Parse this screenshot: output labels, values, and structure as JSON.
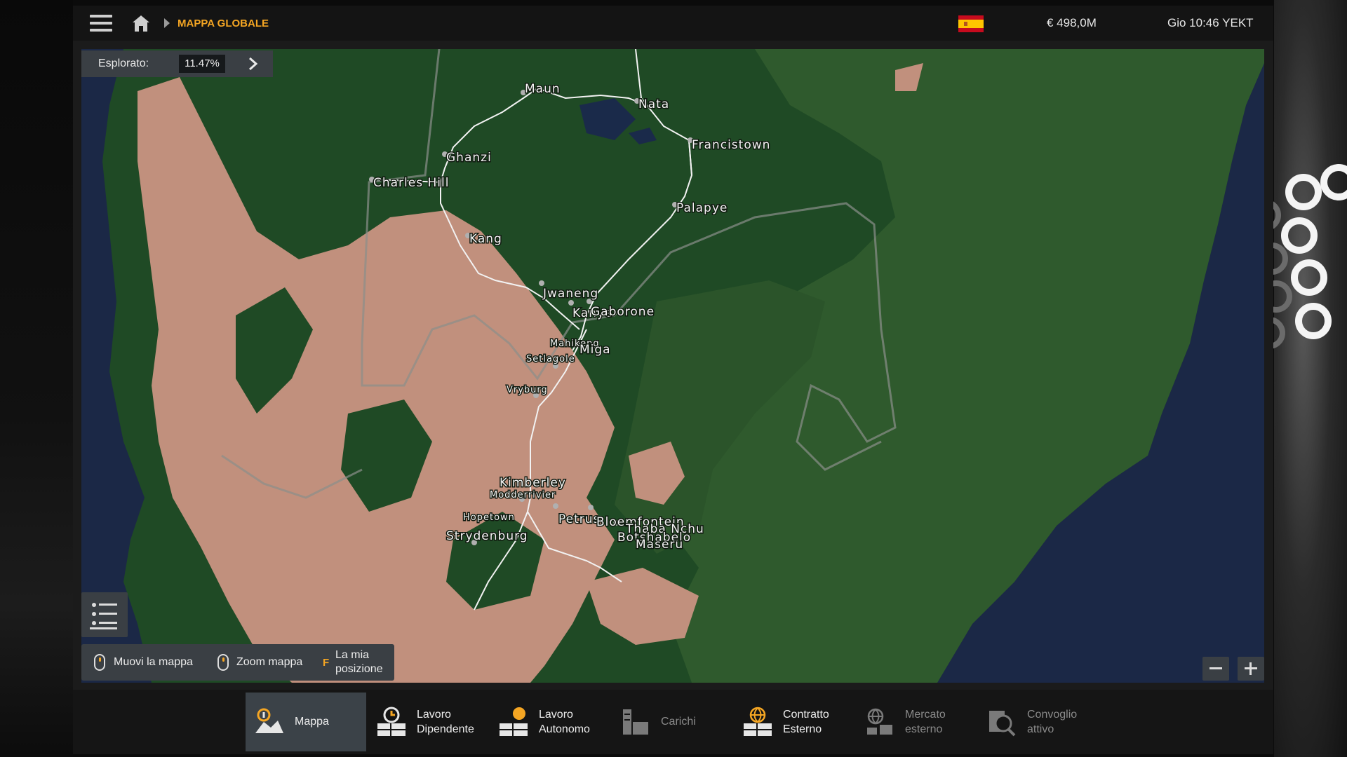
{
  "topbar": {
    "breadcrumb": "MAPPA GLOBALE",
    "money": "€ 498,0M",
    "clock": "Gio 10:46 YEKT",
    "flag_country": "Spain",
    "icons": [
      "hamburger-menu-icon",
      "home-icon",
      "breadcrumb-arrow-icon",
      "spain-flag-icon"
    ]
  },
  "explored": {
    "label": "Esplorato:",
    "value": "11.47%"
  },
  "controls": {
    "move_label": "Muovi la mappa",
    "zoom_label": "Zoom mappa",
    "position_key": "F",
    "position_label_line1": "La mia",
    "position_label_line2": "posizione"
  },
  "cities": [
    {
      "name": "Maun"
    },
    {
      "name": "Nata"
    },
    {
      "name": "Francistown"
    },
    {
      "name": "Ghanzi"
    },
    {
      "name": "Charles Hill"
    },
    {
      "name": "Palapye"
    },
    {
      "name": "Kang"
    },
    {
      "name": "Jwaneng"
    },
    {
      "name": "Kanye"
    },
    {
      "name": "Gaborone"
    },
    {
      "name": "Mahikeng"
    },
    {
      "name": "Miga"
    },
    {
      "name": "Setlagole"
    },
    {
      "name": "Vryburg"
    },
    {
      "name": "Kimberley"
    },
    {
      "name": "Modderrivier"
    },
    {
      "name": "Hopetown"
    },
    {
      "name": "Petrus"
    },
    {
      "name": "Bloemfontein"
    },
    {
      "name": "Thaba Nchu"
    },
    {
      "name": "Botshabelo"
    },
    {
      "name": "Maseru"
    },
    {
      "name": "Strydenburg"
    }
  ],
  "nav": [
    {
      "line1": "Mappa",
      "line2": "",
      "icon": "map-icon",
      "active": true,
      "enabled": true
    },
    {
      "line1": "Lavoro",
      "line2": "Dipendente",
      "icon": "clock-job-icon",
      "active": false,
      "enabled": true
    },
    {
      "line1": "Lavoro",
      "line2": "Autonomo",
      "icon": "freight-job-icon",
      "active": false,
      "enabled": true
    },
    {
      "line1": "Carichi",
      "line2": "",
      "icon": "cargo-icon",
      "active": false,
      "enabled": false
    },
    {
      "line1": "Contratto",
      "line2": "Esterno",
      "icon": "globe-contract-icon",
      "active": false,
      "enabled": true
    },
    {
      "line1": "Mercato",
      "line2": "esterno",
      "icon": "globe-market-icon",
      "active": false,
      "enabled": false
    },
    {
      "line1": "Convoglio",
      "line2": "attivo",
      "icon": "convoy-icon",
      "active": false,
      "enabled": false
    }
  ],
  "colors": {
    "accent": "#f5a623",
    "panel": "#3a3f44",
    "forest": "#1e4a24",
    "grassland": "#2f5a2c",
    "desert": "#c1907d",
    "ocean": "#1a2a4a"
  }
}
